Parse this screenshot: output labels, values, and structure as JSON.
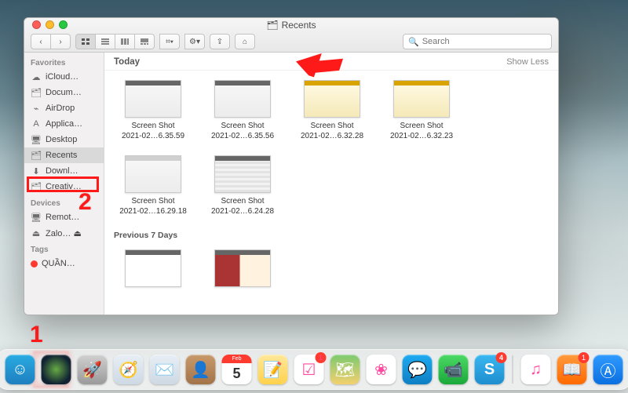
{
  "window": {
    "title": "Recents",
    "traffic": {
      "close": "close",
      "min": "minimize",
      "max": "maximize"
    },
    "toolbar": {
      "back": "‹",
      "forward": "›",
      "view_icons": "icon-view",
      "view_list": "list-view",
      "view_col": "column-view",
      "view_gallery": "gallery-view",
      "group": "⌗▾",
      "action": "⚙︎▾",
      "share": "⇪",
      "tags": "⌂"
    },
    "search": {
      "placeholder": "Search",
      "value": ""
    }
  },
  "sidebar": {
    "sections": [
      {
        "title": "Favorites",
        "items": [
          {
            "icon": "☁︎",
            "label": "iCloud…"
          },
          {
            "icon": "🗂",
            "label": "Docum…"
          },
          {
            "icon": "⌁",
            "label": "AirDrop"
          },
          {
            "icon": "A",
            "label": "Applica…"
          },
          {
            "icon": "🖥",
            "label": "Desktop"
          },
          {
            "icon": "🗂",
            "label": "Recents",
            "selected": true
          },
          {
            "icon": "⬇︎",
            "label": "Downl…"
          },
          {
            "icon": "🗂",
            "label": "Creativ…"
          }
        ]
      },
      {
        "title": "Devices",
        "items": [
          {
            "icon": "🖥",
            "label": "Remot…"
          },
          {
            "icon": "⏏",
            "label": "Zalo… ⏏"
          }
        ]
      },
      {
        "title": "Tags",
        "items": [
          {
            "color": "#ff3b30",
            "label": "QUẦN…"
          }
        ]
      }
    ]
  },
  "content": {
    "section1_title": "Today",
    "show_less": "Show Less",
    "today": [
      {
        "line1": "Screen Shot",
        "line2": "2021-02…6.35.59",
        "style": "dark"
      },
      {
        "line1": "Screen Shot",
        "line2": "2021-02…6.35.56",
        "style": "dark"
      },
      {
        "line1": "Screen Shot",
        "line2": "2021-02…6.32.28",
        "style": "ylw"
      },
      {
        "line1": "Screen Shot",
        "line2": "2021-02…6.32.23",
        "style": "ylw"
      },
      {
        "line1": "Screen Shot",
        "line2": "2021-02…16.29.18",
        "style": "blank"
      },
      {
        "line1": "Screen Shot",
        "line2": "2021-02…6.24.28",
        "style": "kb"
      }
    ],
    "section2_title": "Previous 7 Days",
    "prev": [
      {
        "style": "ptrn"
      },
      {
        "style": "card"
      }
    ]
  },
  "dock": {
    "items": [
      {
        "name": "finder",
        "bg": "linear-gradient(#29abe2,#1e7fbf)",
        "glyph": "☺"
      },
      {
        "name": "siri",
        "bg": "radial-gradient(circle,#6a4,#123 70%)",
        "glyph": ""
      },
      {
        "name": "launchpad",
        "bg": "linear-gradient(#d0d0d0,#9a9a9a)",
        "glyph": "🚀"
      },
      {
        "name": "safari",
        "bg": "linear-gradient(#e8eef5,#cdd9e4)",
        "glyph": "🧭"
      },
      {
        "name": "mail",
        "bg": "linear-gradient(#e8eef5,#cdd9e4)",
        "glyph": "✉️"
      },
      {
        "name": "contacts",
        "bg": "linear-gradient(#c79a6a,#a3744a)",
        "glyph": "👤"
      },
      {
        "name": "calendar",
        "bg": "#fff",
        "glyph": "5",
        "sub": "Feb",
        "badge": ""
      },
      {
        "name": "notes",
        "bg": "linear-gradient(#ffe89a,#ffd24d)",
        "glyph": "📝"
      },
      {
        "name": "reminders",
        "bg": "#fff",
        "glyph": "☑︎",
        "badge": "1"
      },
      {
        "name": "maps",
        "bg": "linear-gradient(#7cc96f,#f4d06f)",
        "glyph": "🗺"
      },
      {
        "name": "photos",
        "bg": "#fff",
        "glyph": "❀"
      },
      {
        "name": "messages",
        "bg": "linear-gradient(#1eaaf1,#0d7fc4)",
        "glyph": "💬"
      },
      {
        "name": "facetime",
        "bg": "linear-gradient(#4cd964,#1aa93a)",
        "glyph": "📹"
      },
      {
        "name": "skype",
        "bg": "linear-gradient(#3ab7f0,#1e8ed0)",
        "glyph": "S",
        "badge": "4"
      },
      {
        "sep": true
      },
      {
        "name": "itunes",
        "bg": "#fff",
        "glyph": "♫"
      },
      {
        "name": "ibooks",
        "bg": "linear-gradient(#ff9a3c,#ff6a00)",
        "glyph": "📖",
        "badge": "1"
      },
      {
        "name": "appstore",
        "bg": "linear-gradient(#2f9bff,#0b6fe0)",
        "glyph": "Ⓐ"
      }
    ]
  },
  "annotations": {
    "num1": "1",
    "num2": "2"
  }
}
